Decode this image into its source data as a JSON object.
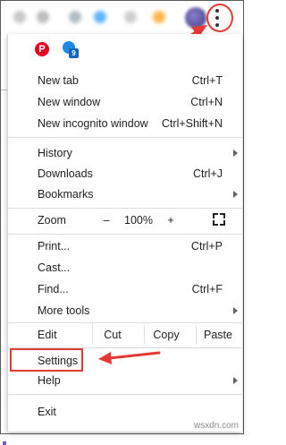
{
  "toolbar": {
    "icons": [
      "extension-icon",
      "extension-icon",
      "extension-icon",
      "extension-icon",
      "extension-icon",
      "extension-icon",
      "profile-avatar",
      "more-menu-icon"
    ],
    "accent_color": "#e53935"
  },
  "bookmarks": {
    "pinterest_glyph": "P",
    "badge_number": "9"
  },
  "menu": {
    "new_tab": {
      "label": "New tab",
      "shortcut": "Ctrl+T"
    },
    "new_window": {
      "label": "New window",
      "shortcut": "Ctrl+N"
    },
    "new_incognito": {
      "label": "New incognito window",
      "shortcut": "Ctrl+Shift+N"
    },
    "history": {
      "label": "History"
    },
    "downloads": {
      "label": "Downloads",
      "shortcut": "Ctrl+J"
    },
    "bookmarks": {
      "label": "Bookmarks"
    },
    "zoom": {
      "label": "Zoom",
      "minus": "–",
      "value": "100%",
      "plus": "+"
    },
    "print": {
      "label": "Print...",
      "shortcut": "Ctrl+P"
    },
    "cast": {
      "label": "Cast..."
    },
    "find": {
      "label": "Find...",
      "shortcut": "Ctrl+F"
    },
    "more_tools": {
      "label": "More tools"
    },
    "edit": {
      "label": "Edit",
      "cut": "Cut",
      "copy": "Copy",
      "paste": "Paste"
    },
    "settings": {
      "label": "Settings"
    },
    "help": {
      "label": "Help"
    },
    "exit": {
      "label": "Exit"
    }
  },
  "watermark": "wsxdn.com"
}
